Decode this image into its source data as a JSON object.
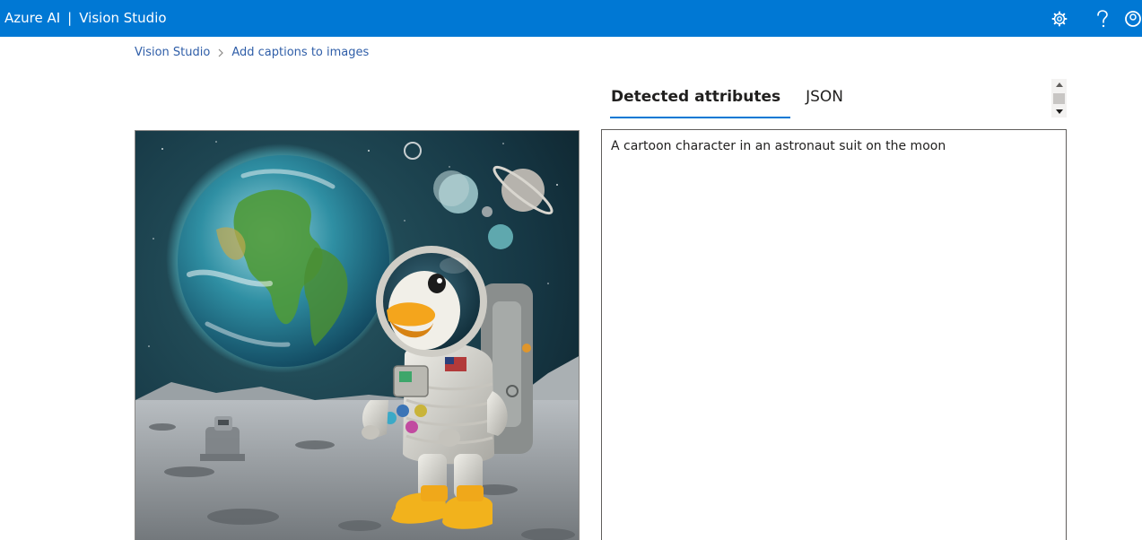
{
  "header": {
    "brand_primary": "Azure AI",
    "brand_divider": "|",
    "brand_secondary": "Vision Studio",
    "icons": [
      "gear-icon",
      "help-icon",
      "account-icon"
    ],
    "background_color": "#0078d4"
  },
  "breadcrumb": {
    "items": [
      {
        "label": "Vision Studio"
      },
      {
        "label": "Add captions to images"
      }
    ],
    "separator_icon": "chevron-right-icon",
    "link_color": "#2f5ea8"
  },
  "image_panel": {
    "image_icon": "astronaut-duck-on-moon-image"
  },
  "results": {
    "tabs": [
      {
        "label": "Detected attributes",
        "active": true
      },
      {
        "label": "JSON",
        "active": false
      }
    ],
    "caption": "A cartoon character in an astronaut suit on the moon",
    "accent_color": "#0078d4"
  }
}
